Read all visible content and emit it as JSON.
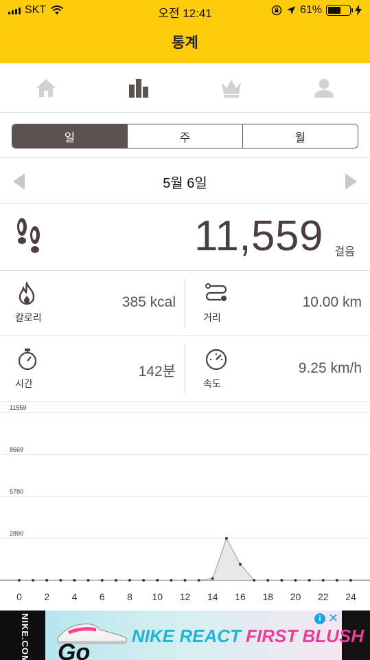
{
  "status": {
    "carrier": "SKT",
    "time": "오전 12:41",
    "battery_pct_text": "61%",
    "battery_level": 0.61
  },
  "header": {
    "title": "통계"
  },
  "nav": {
    "tabs": [
      {
        "icon": "home-icon"
      },
      {
        "icon": "bar-chart-icon",
        "active": true
      },
      {
        "icon": "crown-icon"
      },
      {
        "icon": "person-icon"
      }
    ]
  },
  "period": {
    "options": [
      "일",
      "주",
      "월"
    ],
    "selected": "일"
  },
  "date": {
    "label": "5월 6일"
  },
  "steps": {
    "value": "11,559",
    "unit": "걸음",
    "icon": "footprints-icon"
  },
  "stats": {
    "calories": {
      "label": "칼로리",
      "value": "385 kcal",
      "icon": "flame-icon"
    },
    "distance": {
      "label": "거리",
      "value": "10.00 km",
      "icon": "route-icon"
    },
    "time": {
      "label": "시간",
      "value": "142분",
      "icon": "stopwatch-icon"
    },
    "speed": {
      "label": "속도",
      "value": "9.25 km/h",
      "icon": "speedometer-icon"
    }
  },
  "chart_data": {
    "type": "area",
    "x": [
      0,
      1,
      2,
      3,
      4,
      5,
      6,
      7,
      8,
      9,
      10,
      11,
      12,
      13,
      14,
      15,
      16,
      17,
      18,
      19,
      20,
      21,
      22,
      23,
      24
    ],
    "values": [
      0,
      0,
      0,
      0,
      0,
      0,
      0,
      0,
      0,
      0,
      0,
      0,
      0,
      0,
      120,
      2890,
      1100,
      0,
      0,
      0,
      0,
      0,
      0,
      0,
      0
    ],
    "x_ticks": [
      "0",
      "2",
      "4",
      "6",
      "8",
      "10",
      "12",
      "14",
      "16",
      "18",
      "20",
      "22",
      "24"
    ],
    "y_ticks": [
      "11559",
      "8669",
      "5780",
      "2890",
      "0"
    ],
    "ylim": [
      0,
      11559
    ],
    "grid": true,
    "colors": {
      "line": "#aaaaaa",
      "fill": "#e8e8e8",
      "point": "#3a3a3a"
    }
  },
  "ad": {
    "brand": "NIKE.COM",
    "headline_a": "NIKE REACT",
    "headline_b": "FIRST BLUSH",
    "go": "Go",
    "info": "i",
    "close": "✕"
  }
}
